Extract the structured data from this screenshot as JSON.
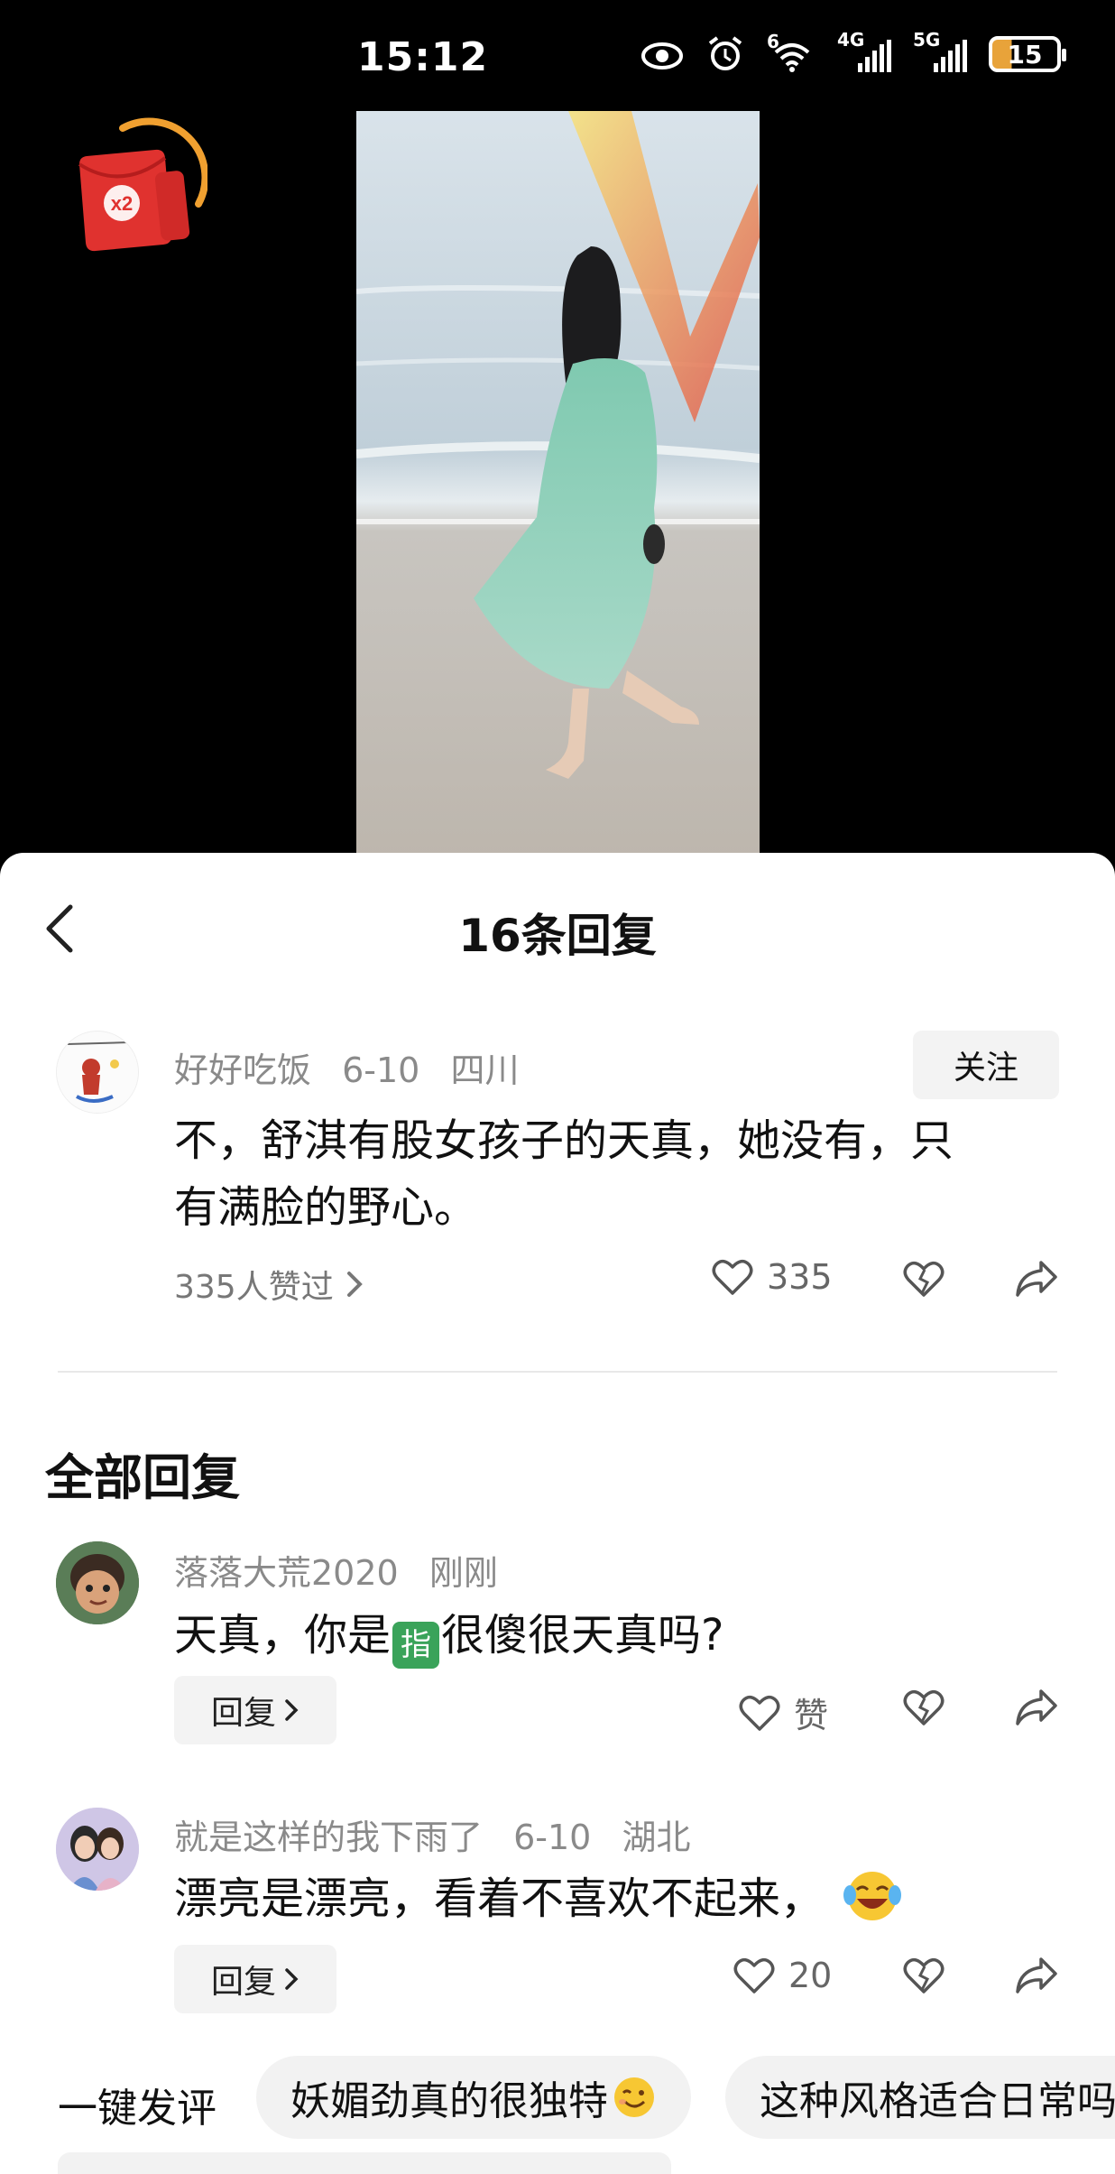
{
  "status_bar": {
    "time": "15:12",
    "battery": "15",
    "net1": "6",
    "net2": "4G",
    "net3": "5G",
    "icons": [
      "eye-icon",
      "alarm-icon",
      "wifi-icon",
      "signal-icon",
      "signal-icon",
      "battery-icon"
    ]
  },
  "red_packet": {
    "label": "x2"
  },
  "sheet": {
    "title": "16条回复",
    "main_comment": {
      "user": "好好吃饭",
      "date": "6-10",
      "location": "四川",
      "follow_label": "关注",
      "text_line1": "不，舒淇有股女孩子的天真，她没有，只",
      "text_line2": "有满脸的野心。",
      "likers": "335人赞过",
      "like_count": "335"
    },
    "section_title": "全部回复",
    "replies": [
      {
        "user": "落落大荒2020",
        "date": "刚刚",
        "text_pre": "天真，你是",
        "tag": "指",
        "text_post": "很傻很天真吗?",
        "reply_label": "回复",
        "like_label": "赞"
      },
      {
        "user": "就是这样的我下雨了",
        "date": "6-10",
        "location": "湖北",
        "text": "漂亮是漂亮，看着不喜欢不起来，",
        "reply_label": "回复",
        "like_label": "20"
      }
    ],
    "quick": {
      "label": "一键发评",
      "chip1": "妖媚劲真的很独特",
      "chip2": "这种风格适合日常吗"
    }
  },
  "colors": {
    "accent_green": "#3aa35a",
    "packet_red": "#e0322f",
    "packet_orange": "#f0a030"
  }
}
